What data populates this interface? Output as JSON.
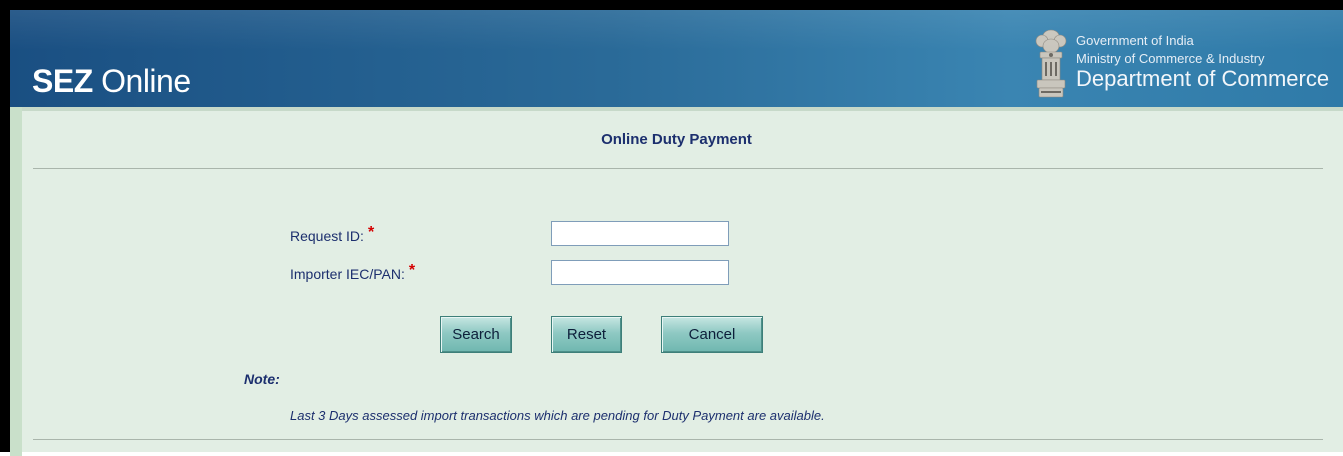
{
  "header": {
    "app_title_bold": "SEZ",
    "app_title_rest": " Online",
    "gov_line1": "Government of India",
    "gov_line2": "Ministry of Commerce & Industry",
    "gov_line3": "Department of Commerce",
    "emblem_icon": "national-emblem-icon"
  },
  "page": {
    "title": "Online Duty Payment"
  },
  "form": {
    "request_id_label": "Request ID:",
    "request_id_value": "",
    "importer_label": "Importer IEC/PAN:",
    "importer_value": "",
    "required_marker": "*"
  },
  "buttons": {
    "search": "Search",
    "reset": "Reset",
    "cancel": "Cancel"
  },
  "note": {
    "label": "Note:",
    "text": "Last 3 Days assessed import transactions which are pending for Duty Payment are available."
  },
  "colors": {
    "header_blue": "#2a6a98",
    "content_bg": "#e2eee4",
    "text_navy": "#1c2f6e",
    "required_red": "#d40000",
    "button_teal": "#8fc9c3"
  }
}
